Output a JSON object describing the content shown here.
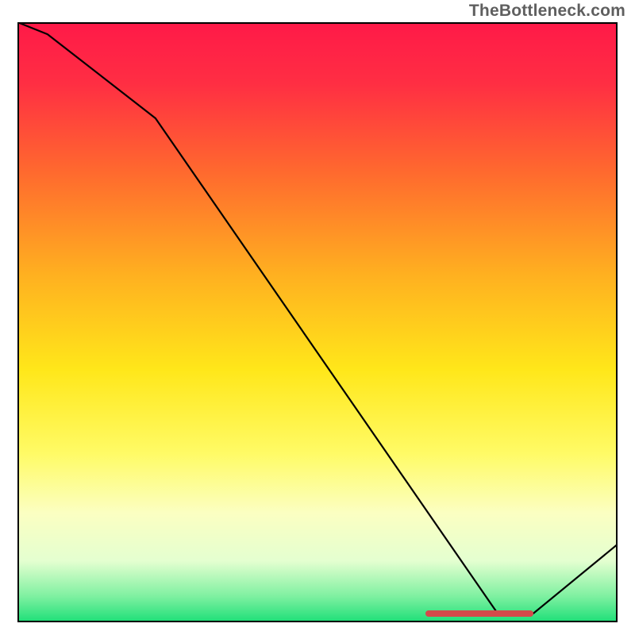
{
  "watermark_text": "TheBottleneck.com",
  "chart_data": {
    "type": "line",
    "title": "",
    "xlabel": "",
    "ylabel": "",
    "xlim": [
      0,
      100
    ],
    "ylim": [
      0,
      100
    ],
    "series": [
      {
        "name": "curve",
        "x": [
          0,
          5,
          23,
          80,
          86,
          100
        ],
        "values": [
          100,
          98,
          84,
          1.5,
          1.5,
          13
        ]
      }
    ],
    "optimal_band": {
      "x_start": 68,
      "x_end": 86,
      "y": 1.5
    },
    "gradient_stops": [
      {
        "pct": 0,
        "color": "#ff1a48"
      },
      {
        "pct": 10,
        "color": "#ff2e43"
      },
      {
        "pct": 25,
        "color": "#ff6a2e"
      },
      {
        "pct": 42,
        "color": "#ffb020"
      },
      {
        "pct": 58,
        "color": "#ffe71a"
      },
      {
        "pct": 72,
        "color": "#fffb66"
      },
      {
        "pct": 82,
        "color": "#fbffc2"
      },
      {
        "pct": 90,
        "color": "#e4ffd0"
      },
      {
        "pct": 96,
        "color": "#7df0a0"
      },
      {
        "pct": 100,
        "color": "#22e07a"
      }
    ],
    "colors": {
      "line": "#000000",
      "marker": "#d44a4a",
      "border": "#000000"
    }
  }
}
